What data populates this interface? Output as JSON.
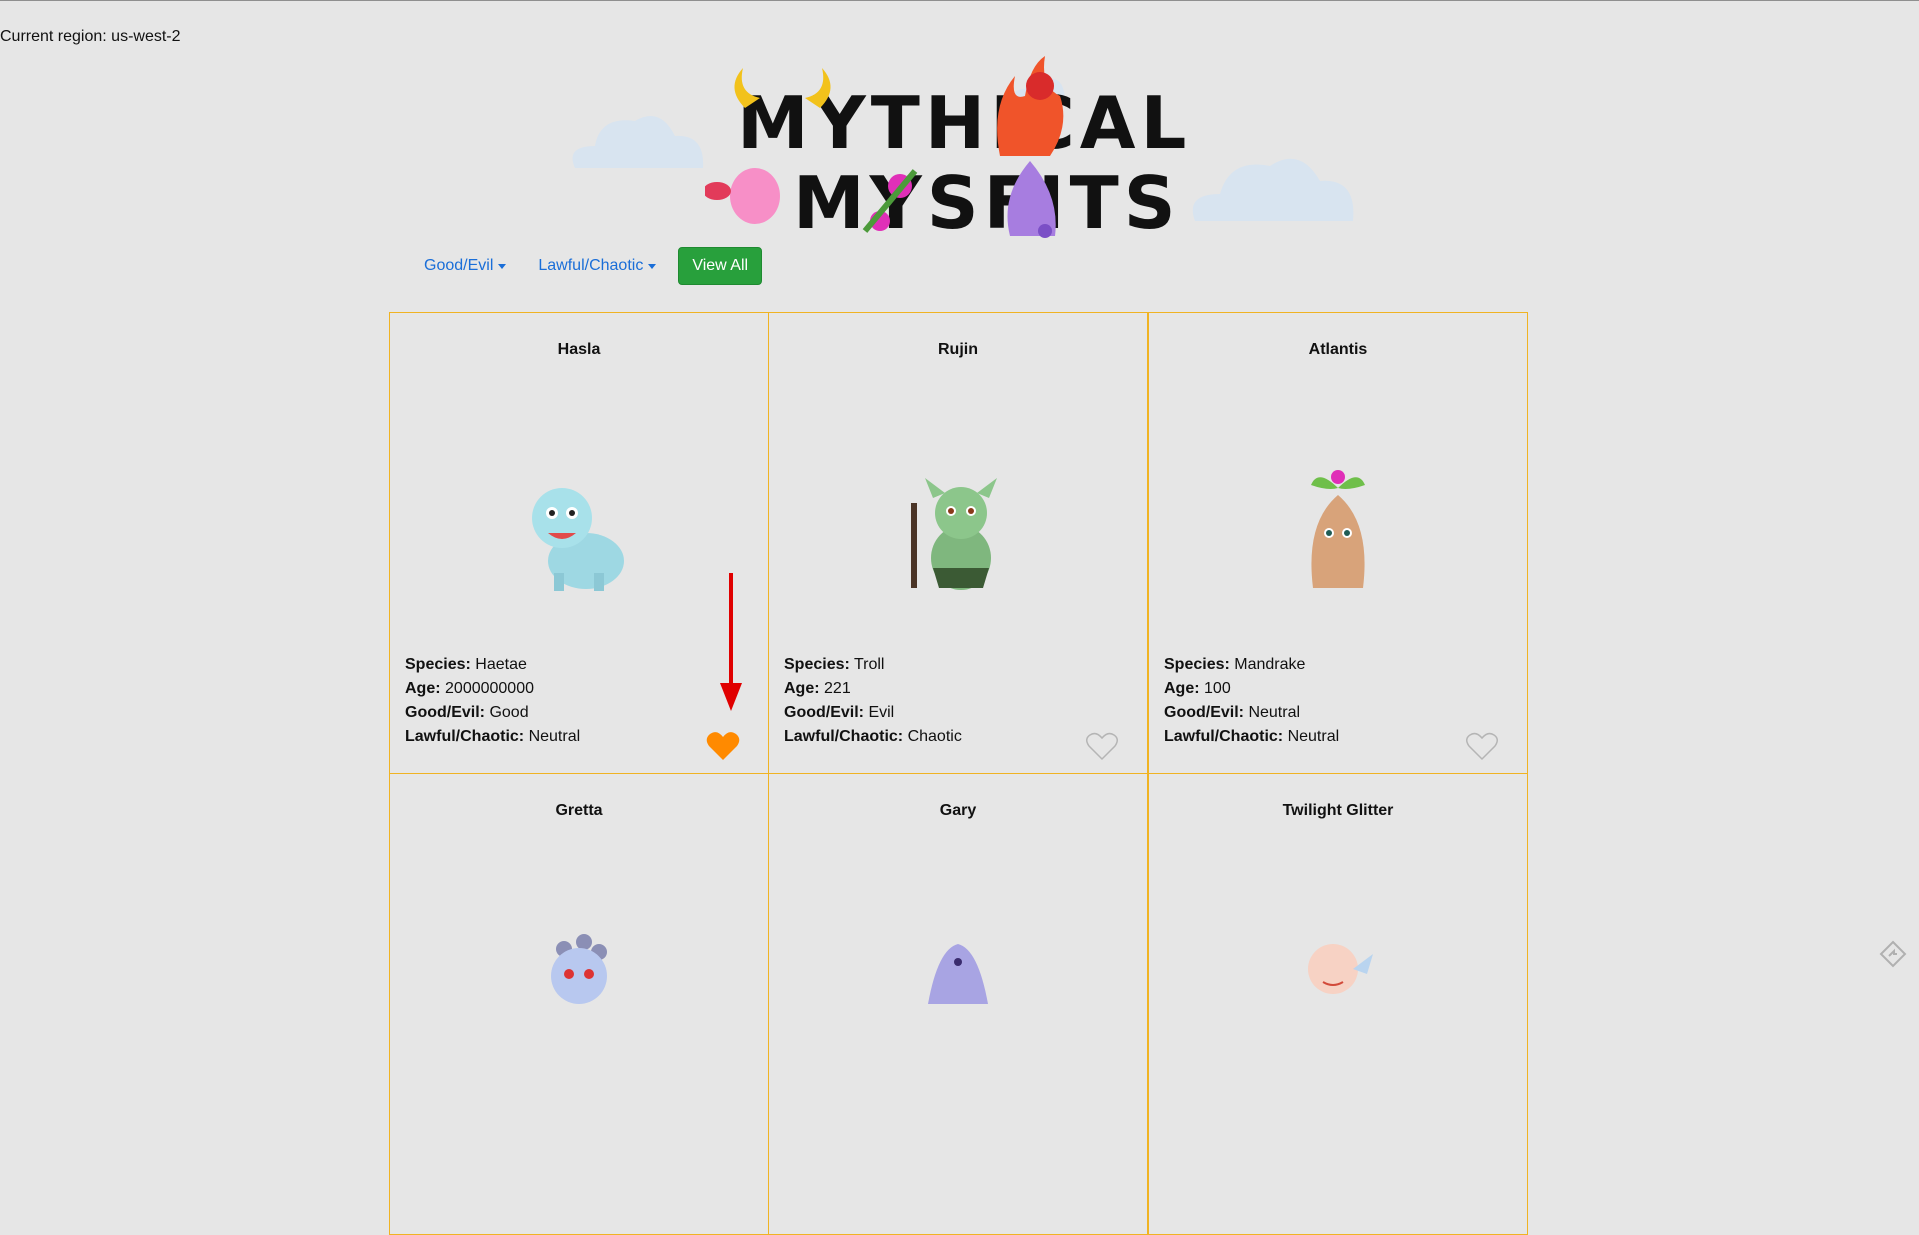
{
  "region_text": "Current region: us-west-2",
  "logo": {
    "line1": "MYTHICAL",
    "line2": "MYSFITS"
  },
  "nav": {
    "good_evil_label": "Good/Evil",
    "lawful_chaotic_label": "Lawful/Chaotic",
    "view_all_label": "View All"
  },
  "labels": {
    "species": "Species:",
    "age": "Age:",
    "good_evil": "Good/Evil:",
    "lawful_chaotic": "Lawful/Chaotic:"
  },
  "colors": {
    "card_border": "#f0b323",
    "liked_heart": "#ff8a00",
    "view_all_bg": "#28a03c",
    "link": "#1a6ed8",
    "annotation_arrow": "#e00000"
  },
  "mysfits": [
    {
      "name": "Hasla",
      "species": "Haetae",
      "age": "2000000000",
      "good_evil": "Good",
      "lawful_chaotic": "Neutral",
      "liked": true,
      "creature_icon": "blue-haetae-icon"
    },
    {
      "name": "Rujin",
      "species": "Troll",
      "age": "221",
      "good_evil": "Evil",
      "lawful_chaotic": "Chaotic",
      "liked": false,
      "creature_icon": "green-troll-icon"
    },
    {
      "name": "Atlantis",
      "species": "Mandrake",
      "age": "100",
      "good_evil": "Neutral",
      "lawful_chaotic": "Neutral",
      "liked": false,
      "creature_icon": "mandrake-icon"
    },
    {
      "name": "Gretta",
      "creature_icon": "gretta-creature-icon"
    },
    {
      "name": "Gary",
      "creature_icon": "gary-creature-icon"
    },
    {
      "name": "Twilight Glitter",
      "creature_icon": "twilight-glitter-creature-icon"
    }
  ]
}
